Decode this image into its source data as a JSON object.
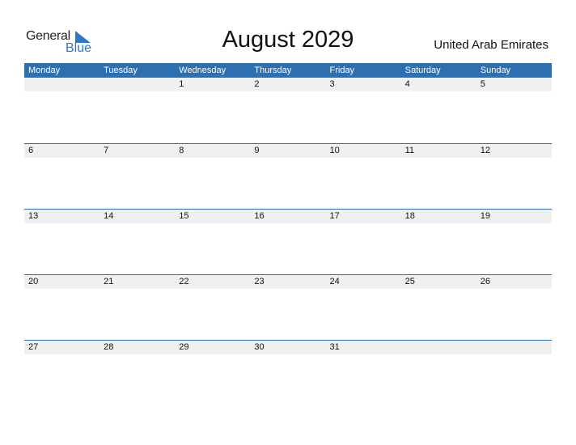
{
  "logo": {
    "general": "General",
    "blue": "Blue",
    "accent": "#2a7ac7"
  },
  "header": {
    "title": "August 2029",
    "country": "United Arab Emirates"
  },
  "calendar": {
    "header_color": "#2e6fb0",
    "weekdays": [
      "Monday",
      "Tuesday",
      "Wednesday",
      "Thursday",
      "Friday",
      "Saturday",
      "Sunday"
    ],
    "weeks": [
      [
        "",
        "",
        "1",
        "2",
        "3",
        "4",
        "5"
      ],
      [
        "6",
        "7",
        "8",
        "9",
        "10",
        "11",
        "12"
      ],
      [
        "13",
        "14",
        "15",
        "16",
        "17",
        "18",
        "19"
      ],
      [
        "20",
        "21",
        "22",
        "23",
        "24",
        "25",
        "26"
      ],
      [
        "27",
        "28",
        "29",
        "30",
        "31",
        "",
        ""
      ]
    ]
  }
}
